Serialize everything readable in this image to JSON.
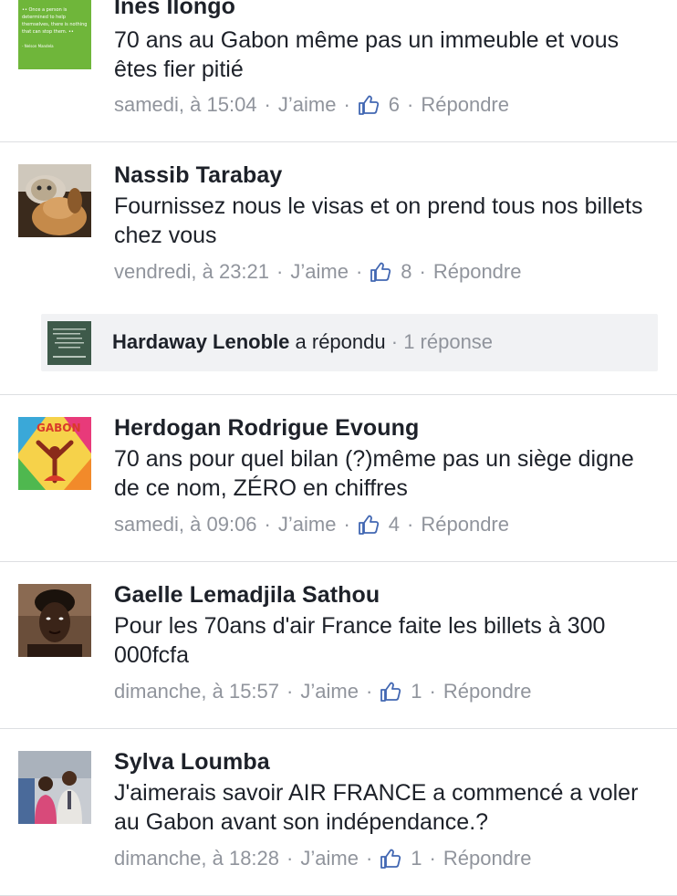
{
  "comments": [
    {
      "name": "Ines Ilongo",
      "text": "70 ans au Gabon même pas un immeuble et vous êtes fier pitié",
      "time": "samedi, à 15:04",
      "like_label": "J’aime",
      "likes": "6",
      "reply_label": "Répondre",
      "avatar_text": "Once a person is determined to help themselves, there is nothing that can stop them."
    },
    {
      "name": "Nassib Tarabay",
      "text": "Fournissez nous le visas et on prend tous nos billets chez vous",
      "time": "vendredi, à 23:21",
      "like_label": "J’aime",
      "likes": "8",
      "reply_label": "Répondre"
    },
    {
      "name": "Herdogan Rodrigue Evoung",
      "text": "70 ans pour quel bilan (?)même pas un siège digne de ce nom, ZÉRO en chiffres",
      "time": "samedi, à 09:06",
      "like_label": "J’aime",
      "likes": "4",
      "reply_label": "Répondre",
      "avatar_text": "GABON"
    },
    {
      "name": "Gaelle Lemadjila Sathou",
      "text": "Pour les 70ans d'air France faite les billets à 300 000fcfa",
      "time": "dimanche, à 15:57",
      "like_label": "J’aime",
      "likes": "1",
      "reply_label": "Répondre"
    },
    {
      "name": "Sylva Loumba",
      "text": "J'aimerais savoir AIR FRANCE a commencé a voler au Gabon avant son indépendance.?",
      "time": "dimanche, à 18:28",
      "like_label": "J’aime",
      "likes": "1",
      "reply_label": "Répondre"
    }
  ],
  "reply": {
    "name": "Hardaway Lenoble",
    "action": "a répondu",
    "count": "1 réponse"
  },
  "colors": {
    "meta": "#90949c",
    "like_icon": "#4267b2",
    "divider": "#dddfe2",
    "reply_bg": "#f1f2f4"
  },
  "icons": {
    "like": "thumbs-up-icon"
  }
}
